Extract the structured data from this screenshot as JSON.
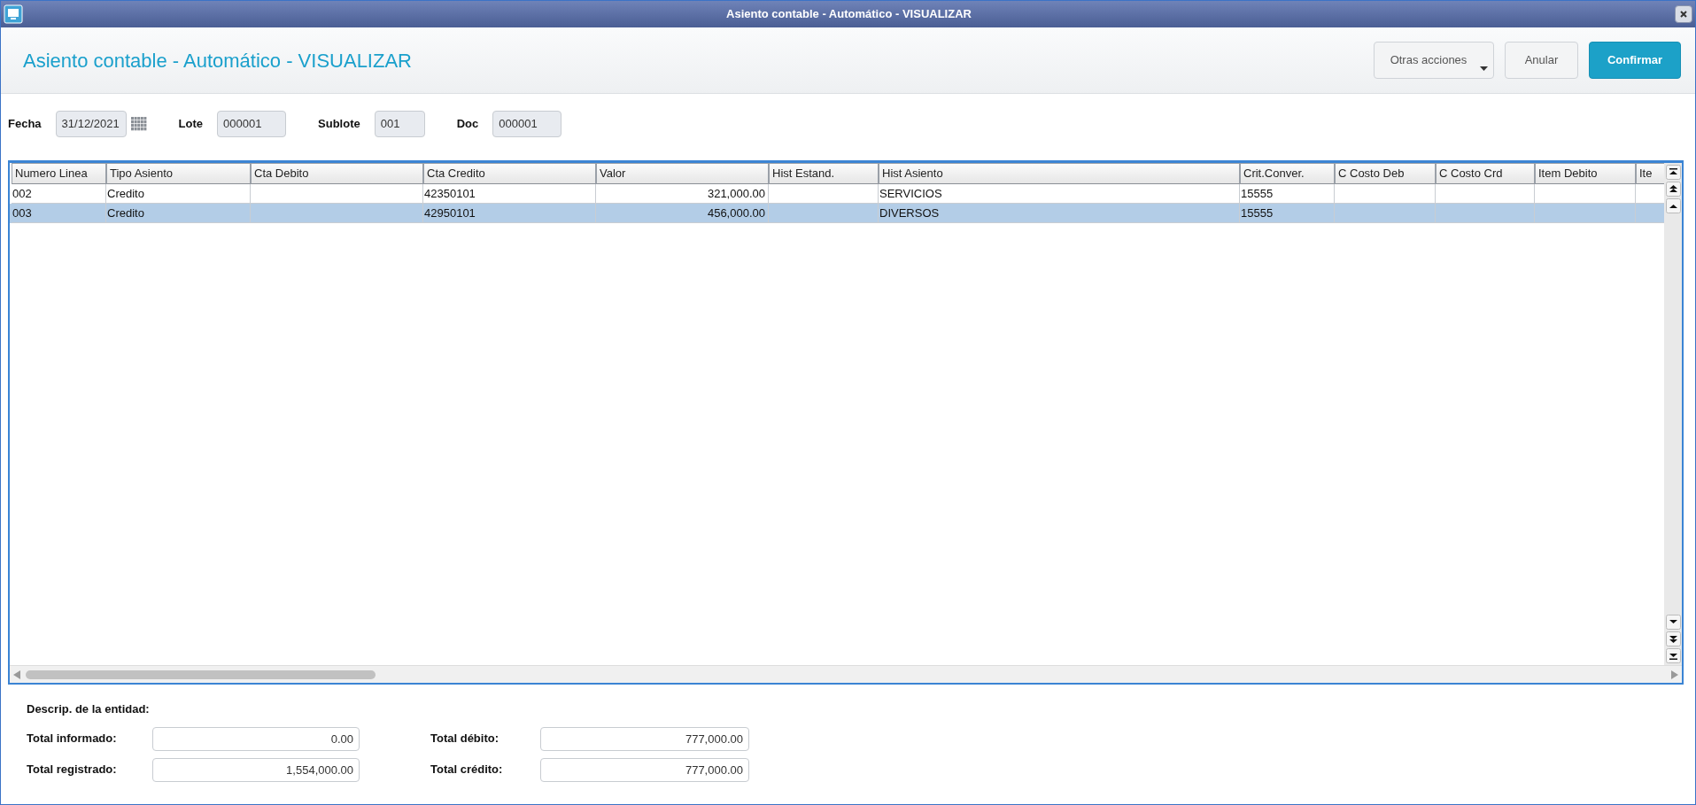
{
  "window": {
    "title": "Asiento contable - Automático - VISUALIZAR"
  },
  "header": {
    "title": "Asiento contable - Automático - VISUALIZAR",
    "buttons": [
      {
        "label": "Otras acciones",
        "kind": "menu"
      },
      {
        "label": "Anular",
        "kind": "plain"
      },
      {
        "label": "Confirmar",
        "kind": "primary"
      }
    ]
  },
  "fields": [
    {
      "label": "Fecha",
      "value": "31/12/2021",
      "kind": "date"
    },
    {
      "label": "Lote",
      "value": "000001",
      "kind": "text"
    },
    {
      "label": "Sublote",
      "value": "001",
      "kind": "text"
    },
    {
      "label": "Doc",
      "value": "000001",
      "kind": "text"
    }
  ],
  "table": {
    "columns": [
      {
        "label": "Numero Linea",
        "kind": "text"
      },
      {
        "label": "Tipo Asiento",
        "kind": "text"
      },
      {
        "label": "Cta Debito",
        "kind": "text"
      },
      {
        "label": "Cta Credito",
        "kind": "text"
      },
      {
        "label": "Valor",
        "kind": "amount"
      },
      {
        "label": "Hist Estand.",
        "kind": "text"
      },
      {
        "label": "Hist Asiento",
        "kind": "text"
      },
      {
        "label": "Crit.Conver.",
        "kind": "text"
      },
      {
        "label": "C Costo Deb",
        "kind": "text"
      },
      {
        "label": "C Costo Crd",
        "kind": "text"
      },
      {
        "label": "Item Debito",
        "kind": "text"
      },
      {
        "label": "Ite",
        "kind": "text"
      }
    ],
    "rows": [
      {
        "selected": false,
        "cells": [
          "002",
          "Credito",
          "",
          "42350101",
          "321,000.00",
          "",
          "SERVICIOS",
          "15555",
          "",
          "",
          "",
          ""
        ]
      },
      {
        "selected": true,
        "cells": [
          "003",
          "Credito",
          "",
          "42950101",
          "456,000.00",
          "",
          "DIVERSOS",
          "15555",
          "",
          "",
          "",
          ""
        ]
      }
    ]
  },
  "footer": {
    "description_label": "Descrip. de la entidad:",
    "totals": [
      {
        "label": "Total informado:",
        "value": "0.00"
      },
      {
        "label": "Total débito:",
        "value": "777,000.00"
      },
      {
        "label": "Total registrado:",
        "value": "1,554,000.00"
      },
      {
        "label": "Total crédito:",
        "value": "777,000.00"
      }
    ]
  }
}
